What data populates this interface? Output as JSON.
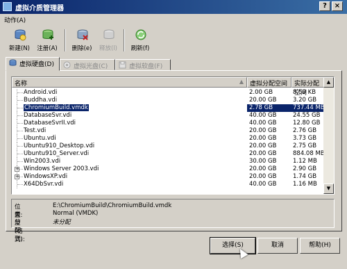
{
  "window": {
    "title": "虚拟介质管理器",
    "help_glyph": "?",
    "close_glyph": "×"
  },
  "menu": {
    "action_label": "动作(A)"
  },
  "toolbar": {
    "new_label": "新建(N)",
    "register_label": "注册(A)",
    "delete_label": "删除(e)",
    "release_label": "释放(l)",
    "refresh_label": "刷新(f)"
  },
  "tabs": [
    {
      "label": "虚拟硬盘(D)",
      "active": true,
      "icon": "hard-disk-icon"
    },
    {
      "label": "虚拟光盘(C)",
      "active": false,
      "icon": "cd-icon"
    },
    {
      "label": "虚拟软盘(F)",
      "active": false,
      "icon": "floppy-icon"
    }
  ],
  "list": {
    "headers": {
      "name": "名称",
      "virtual_size": "虚拟分配空间",
      "actual_size": "实际分配空间",
      "sort_glyph": "▲"
    },
    "rows": [
      {
        "name": "Android.vdi",
        "virtual": "2.00 GB",
        "actual": "8.50 KB"
      },
      {
        "name": "Buddha.vdi",
        "virtual": "20.00 GB",
        "actual": "3.20 GB"
      },
      {
        "name": "ChromiumBuild.vmdk",
        "virtual": "2.78 GB",
        "actual": "737.44 MB"
      },
      {
        "name": "DatabaseSvr.vdi",
        "virtual": "40.00 GB",
        "actual": "24.55 GB"
      },
      {
        "name": "DatabaseSvrII.vdi",
        "virtual": "40.00 GB",
        "actual": "12.80 GB"
      },
      {
        "name": "Test.vdi",
        "virtual": "20.00 GB",
        "actual": "2.76 GB"
      },
      {
        "name": "Ubuntu.vdi",
        "virtual": "20.00 GB",
        "actual": "3.73 GB"
      },
      {
        "name": "Ubuntu910_Desktop.vdi",
        "virtual": "20.00 GB",
        "actual": "2.75 GB"
      },
      {
        "name": "Ubuntu910_Server.vdi",
        "virtual": "20.00 GB",
        "actual": "884.08 MB"
      },
      {
        "name": "Win2003.vdi",
        "virtual": "30.00 GB",
        "actual": "1.12 MB"
      },
      {
        "name": "Windows Server 2003.vdi",
        "virtual": "20.00 GB",
        "actual": "2.90 GB"
      },
      {
        "name": "WindowsXP.vdi",
        "virtual": "20.00 GB",
        "actual": "1.74 GB"
      },
      {
        "name": "X64DbSvr.vdi",
        "virtual": "40.00 GB",
        "actual": "1.16 MB"
      }
    ],
    "selected_index": 2,
    "expander_glyph": "+"
  },
  "info": {
    "location_label": "位置:",
    "location_value": "E:\\ChromiumBuild\\ChromiumBuild.vmdk",
    "type_label": "类型 (格式):",
    "type_value": "Normal (VMDK)",
    "attached_label": "分配到:",
    "attached_value": "未分配"
  },
  "buttons": {
    "select_label": "选择(S)",
    "cancel_label": "取消",
    "help_label": "帮助(H)"
  },
  "colors": {
    "title_start": "#0a246a",
    "title_end": "#3a6ea5",
    "selection": "#0a246a",
    "face": "#d4d0c8"
  }
}
